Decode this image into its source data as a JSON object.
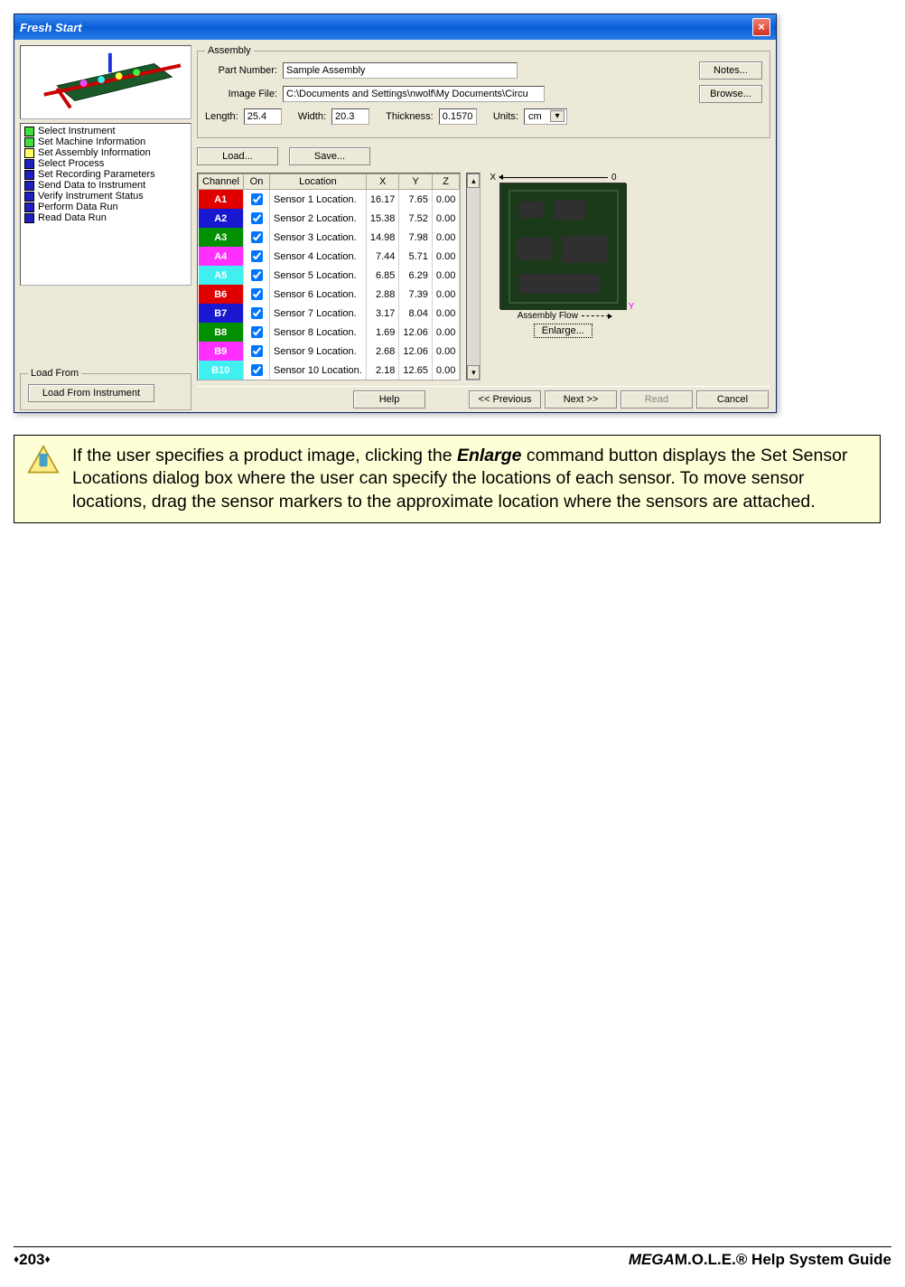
{
  "dialog": {
    "title": "Fresh Start",
    "steps": [
      {
        "color": "#3ee03e",
        "label": "Select Instrument"
      },
      {
        "color": "#3ee03e",
        "label": "Set Machine Information"
      },
      {
        "color": "#ffff66",
        "label": "Set Assembly Information"
      },
      {
        "color": "#2020c0",
        "label": "Select Process"
      },
      {
        "color": "#2020c0",
        "label": "Set Recording Parameters"
      },
      {
        "color": "#2020c0",
        "label": "Send Data to Instrument"
      },
      {
        "color": "#2020c0",
        "label": "Verify Instrument Status"
      },
      {
        "color": "#2020c0",
        "label": "Perform Data Run"
      },
      {
        "color": "#2020c0",
        "label": "Read Data Run"
      }
    ],
    "loadFromLegend": "Load From",
    "loadFromBtn": "Load From Instrument",
    "assembly": {
      "legend": "Assembly",
      "partLabel": "Part Number:",
      "partValue": "Sample Assembly",
      "imageLabel": "Image File:",
      "imageValue": "C:\\Documents and Settings\\nwolf\\My Documents\\Circu",
      "lengthLabel": "Length:",
      "lengthValue": "25.4",
      "widthLabel": "Width:",
      "widthValue": "20.3",
      "thickLabel": "Thickness:",
      "thickValue": "0.1570",
      "unitsLabel": "Units:",
      "unitsValue": "cm",
      "notesBtn": "Notes...",
      "browseBtn": "Browse...",
      "loadBtn": "Load...",
      "saveBtn": "Save..."
    },
    "table": {
      "headers": [
        "Channel",
        "On",
        "Location",
        "X",
        "Y",
        "Z"
      ],
      "rows": [
        {
          "ch": "A1",
          "bg": "#e00000",
          "on": true,
          "loc": "Sensor 1 Location.",
          "x": "16.17",
          "y": "7.65",
          "z": "0.00"
        },
        {
          "ch": "A2",
          "bg": "#1818d0",
          "on": true,
          "loc": "Sensor 2 Location.",
          "x": "15.38",
          "y": "7.52",
          "z": "0.00"
        },
        {
          "ch": "A3",
          "bg": "#009000",
          "on": true,
          "loc": "Sensor 3 Location.",
          "x": "14.98",
          "y": "7.98",
          "z": "0.00"
        },
        {
          "ch": "A4",
          "bg": "#ff30ff",
          "on": true,
          "loc": "Sensor 4 Location.",
          "x": "7.44",
          "y": "5.71",
          "z": "0.00"
        },
        {
          "ch": "A5",
          "bg": "#40f0f0",
          "on": true,
          "loc": "Sensor 5 Location.",
          "x": "6.85",
          "y": "6.29",
          "z": "0.00"
        },
        {
          "ch": "B6",
          "bg": "#e00000",
          "on": true,
          "loc": "Sensor 6 Location.",
          "x": "2.88",
          "y": "7.39",
          "z": "0.00"
        },
        {
          "ch": "B7",
          "bg": "#1818d0",
          "on": true,
          "loc": "Sensor 7 Location.",
          "x": "3.17",
          "y": "8.04",
          "z": "0.00"
        },
        {
          "ch": "B8",
          "bg": "#009000",
          "on": true,
          "loc": "Sensor 8 Location.",
          "x": "1.69",
          "y": "12.06",
          "z": "0.00"
        },
        {
          "ch": "B9",
          "bg": "#ff30ff",
          "on": true,
          "loc": "Sensor 9 Location.",
          "x": "2.68",
          "y": "12.06",
          "z": "0.00"
        },
        {
          "ch": "B10",
          "bg": "#40f0f0",
          "on": true,
          "loc": "Sensor 10 Location.",
          "x": "2.18",
          "y": "12.65",
          "z": "0.00"
        }
      ]
    },
    "preview": {
      "xLabel": "X",
      "zeroLabel": "0",
      "yLabel": "Y",
      "flowLabel": "Assembly Flow",
      "enlarge": "Enlarge..."
    },
    "nav": {
      "help": "Help",
      "prev": "<< Previous",
      "next": "Next >>",
      "read": "Read",
      "cancel": "Cancel"
    }
  },
  "note": {
    "text_before": "If the user specifies a product image, clicking the ",
    "emph": "Enlarge",
    "text_after": " command button displays the Set Sensor Locations dialog box where the user can specify the locations of each sensor. To move sensor locations, drag the sensor markers to the approximate location where the sensors are attached."
  },
  "footer": {
    "page": "203",
    "guide_prefix": "MEGA",
    "guide_rest": "M.O.L.E.® Help System Guide"
  }
}
